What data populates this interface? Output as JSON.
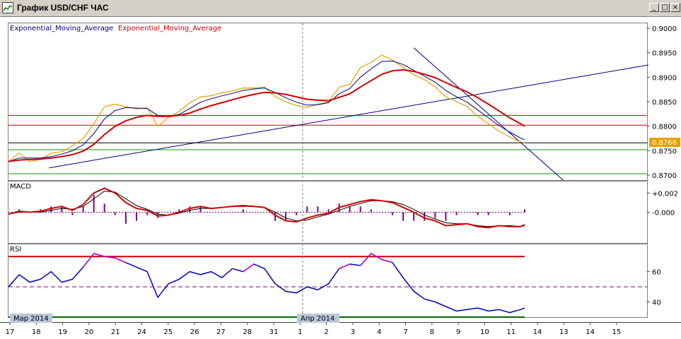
{
  "window": {
    "title": "График USD/CHF ЧАС",
    "minimize_glyph": "_",
    "maximize_glyph": "□",
    "close_glyph": "×"
  },
  "colors": {
    "price": "#e8a000",
    "ema_fast": "#000080",
    "ema_slow": "#d40000",
    "macd_hist": "#800080",
    "rsi": "#0000c0",
    "rsi_hi": "#cc00cc",
    "trend": "#000080",
    "level_red": "#cc0000",
    "level_green": "#00a000",
    "grid": "#808080"
  },
  "chart_data": [
    {
      "type": "line",
      "panel": "price",
      "legend": [
        "Exponential_Moving_Average",
        "Exponential_Moving_Average"
      ],
      "ylim": [
        0.869,
        0.901
      ],
      "yticks": [
        "0.9000",
        "0.8950",
        "0.8900",
        "0.8850",
        "0.8800",
        "0.8750",
        "0.8700"
      ],
      "last_price_label": "0.8766",
      "horizontal_levels": [
        {
          "value": 0.8822,
          "color": "red"
        },
        {
          "value": 0.8802,
          "color": "red"
        },
        {
          "value": 0.8766,
          "color": "black"
        },
        {
          "value": 0.8752,
          "color": "green"
        },
        {
          "value": 0.8703,
          "color": "green"
        }
      ],
      "trendlines": [
        {
          "x": [
            1.9,
            30.0
          ],
          "y": [
            0.8715,
            0.8925
          ]
        },
        {
          "x": [
            19.0,
            26.0
          ],
          "y": [
            0.896,
            0.869
          ]
        }
      ],
      "x": [
        0,
        0.5,
        1,
        1.5,
        2,
        2.5,
        3,
        3.5,
        4,
        4.5,
        5,
        5.5,
        6,
        6.5,
        7,
        7.5,
        8,
        8.5,
        9,
        9.5,
        10,
        10.5,
        11,
        11.5,
        12,
        12.5,
        13,
        13.5,
        14,
        14.5,
        15,
        15.5,
        16,
        16.5,
        17,
        17.5,
        18,
        18.5,
        19,
        19.5,
        20,
        20.5,
        21,
        21.5,
        22,
        22.5,
        23,
        23.5,
        24,
        24.2
      ],
      "series": [
        {
          "role": "price",
          "values": [
            0.8728,
            0.8745,
            0.8728,
            0.8732,
            0.8745,
            0.8748,
            0.876,
            0.8775,
            0.8805,
            0.884,
            0.8845,
            0.884,
            0.8835,
            0.8838,
            0.88,
            0.8818,
            0.883,
            0.8848,
            0.886,
            0.8862,
            0.8868,
            0.8872,
            0.8878,
            0.8878,
            0.888,
            0.886,
            0.885,
            0.8842,
            0.8838,
            0.8845,
            0.885,
            0.888,
            0.8885,
            0.892,
            0.893,
            0.8945,
            0.8935,
            0.892,
            0.8905,
            0.8895,
            0.888,
            0.886,
            0.885,
            0.884,
            0.882,
            0.8805,
            0.879,
            0.8778,
            0.8768,
            0.8766
          ]
        },
        {
          "role": "ema_fast",
          "values": [
            0.8728,
            0.8735,
            0.8735,
            0.8735,
            0.8738,
            0.8743,
            0.875,
            0.8762,
            0.8785,
            0.8815,
            0.8832,
            0.8838,
            0.8837,
            0.8836,
            0.8822,
            0.882,
            0.8824,
            0.8836,
            0.8849,
            0.8856,
            0.8862,
            0.8867,
            0.8873,
            0.8876,
            0.8878,
            0.8869,
            0.8858,
            0.8849,
            0.8843,
            0.8844,
            0.8848,
            0.8866,
            0.8877,
            0.89,
            0.8917,
            0.8932,
            0.8933,
            0.8926,
            0.8914,
            0.8902,
            0.889,
            0.8873,
            0.886,
            0.8849,
            0.8833,
            0.8817,
            0.8801,
            0.8788,
            0.8776,
            0.8772
          ]
        },
        {
          "role": "ema_slow",
          "values": [
            0.8728,
            0.8731,
            0.8732,
            0.8733,
            0.8735,
            0.8738,
            0.8742,
            0.8749,
            0.8763,
            0.8783,
            0.88,
            0.8811,
            0.8818,
            0.8822,
            0.882,
            0.882,
            0.8822,
            0.8827,
            0.8835,
            0.8842,
            0.8848,
            0.8854,
            0.886,
            0.8865,
            0.8869,
            0.8868,
            0.8865,
            0.886,
            0.8855,
            0.8853,
            0.8852,
            0.8859,
            0.8866,
            0.888,
            0.8893,
            0.8906,
            0.8913,
            0.8915,
            0.8912,
            0.8906,
            0.8899,
            0.8889,
            0.8879,
            0.887,
            0.8858,
            0.8845,
            0.8831,
            0.8817,
            0.8805,
            0.88
          ]
        }
      ]
    },
    {
      "type": "line",
      "panel": "macd",
      "label": "MACD",
      "yticks": [
        "+0.002",
        "-0.000"
      ],
      "ylim": [
        -0.0032,
        0.0032
      ],
      "x": [
        0,
        0.5,
        1,
        1.5,
        2,
        2.5,
        3,
        3.5,
        4,
        4.5,
        5,
        5.5,
        6,
        6.5,
        7,
        7.5,
        8,
        8.5,
        9,
        9.5,
        10,
        10.5,
        11,
        11.5,
        12,
        12.5,
        13,
        13.5,
        14,
        14.5,
        15,
        15.5,
        16,
        16.5,
        17,
        17.5,
        18,
        18.5,
        19,
        19.5,
        20,
        20.5,
        21,
        21.5,
        22,
        22.5,
        23,
        23.5,
        24,
        24.2
      ],
      "series": [
        {
          "role": "macd_main",
          "values": [
            -0.0002,
            0.0001,
            0.0,
            0.0001,
            0.0004,
            0.0006,
            0.0002,
            0.0008,
            0.002,
            0.0025,
            0.002,
            0.001,
            0.0004,
            0.0002,
            -0.0004,
            -0.0003,
            0.0,
            0.0004,
            0.0006,
            0.0004,
            0.0005,
            0.0006,
            0.0007,
            0.0006,
            0.0005,
            -0.0003,
            -0.0009,
            -0.001,
            -0.0006,
            -0.0003,
            -0.0001,
            0.0005,
            0.0008,
            0.0011,
            0.0013,
            0.0012,
            0.001,
            0.0005,
            0.0,
            -0.0006,
            -0.0009,
            -0.0014,
            -0.0013,
            -0.0012,
            -0.0015,
            -0.0016,
            -0.0014,
            -0.0015,
            -0.0015,
            -0.0013
          ]
        },
        {
          "role": "macd_signal",
          "values": [
            -0.0002,
            0.0,
            0.0,
            0.0,
            0.0002,
            0.0004,
            0.0003,
            0.0006,
            0.0014,
            0.0022,
            0.0021,
            0.0014,
            0.0007,
            0.0003,
            -0.0002,
            -0.0003,
            -0.0001,
            0.0002,
            0.0004,
            0.0004,
            0.0005,
            0.0006,
            0.0006,
            0.0006,
            0.0005,
            0.0,
            -0.0006,
            -0.0009,
            -0.0008,
            -0.0005,
            -0.0002,
            0.0002,
            0.0006,
            0.0009,
            0.0012,
            0.0012,
            0.0011,
            0.0008,
            0.0003,
            -0.0003,
            -0.0007,
            -0.0011,
            -0.0012,
            -0.0012,
            -0.0014,
            -0.0015,
            -0.0014,
            -0.0014,
            -0.0015,
            -0.0014
          ]
        }
      ]
    },
    {
      "type": "line",
      "panel": "rsi",
      "label": "RSI",
      "yticks": [
        "60",
        "40"
      ],
      "ylim": [
        30,
        78
      ],
      "levels": [
        {
          "value": 70,
          "color": "red"
        },
        {
          "value": 50,
          "color": "purple"
        },
        {
          "value": 30,
          "color": "green"
        }
      ],
      "x": [
        0,
        0.5,
        1,
        1.5,
        2,
        2.5,
        3,
        3.5,
        4,
        4.5,
        5,
        5.5,
        6,
        6.5,
        7,
        7.5,
        8,
        8.5,
        9,
        9.5,
        10,
        10.5,
        11,
        11.5,
        12,
        12.5,
        13,
        13.5,
        14,
        14.5,
        15,
        15.5,
        16,
        16.5,
        17,
        17.5,
        18,
        18.5,
        19,
        19.5,
        20,
        20.5,
        21,
        21.5,
        22,
        22.5,
        23,
        23.5,
        24,
        24.2
      ],
      "values": [
        50,
        58,
        53,
        55,
        60,
        53,
        55,
        63,
        72,
        70,
        69,
        66,
        63,
        60,
        43,
        52,
        55,
        60,
        58,
        60,
        56,
        62,
        60,
        65,
        62,
        52,
        47,
        46,
        50,
        48,
        52,
        62,
        65,
        64,
        72,
        68,
        66,
        56,
        47,
        42,
        40,
        37,
        34,
        35,
        36,
        34,
        35,
        33,
        35,
        36
      ]
    }
  ],
  "xaxis": {
    "ticks": [
      "17",
      "18",
      "19",
      "20",
      "21",
      "24",
      "25",
      "26",
      "27",
      "28",
      "31",
      "1",
      "2",
      "3",
      "4",
      "7",
      "8",
      "9",
      "10",
      "11",
      "14",
      "13",
      "14",
      "15"
    ],
    "month_labels": [
      "Мар 2014",
      "Апр 2014"
    ]
  }
}
